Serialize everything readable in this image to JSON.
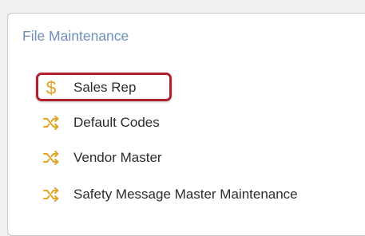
{
  "section": {
    "title": "File Maintenance"
  },
  "menu": {
    "items": [
      {
        "label": "Sales Rep",
        "icon": "dollar-icon",
        "highlighted": true
      },
      {
        "label": "Default Codes",
        "icon": "shuffle-icon",
        "highlighted": false
      },
      {
        "label": "Vendor Master",
        "icon": "shuffle-icon",
        "highlighted": false
      },
      {
        "label": "Safety Message Master Maintenance",
        "icon": "shuffle-icon",
        "highlighted": false
      }
    ]
  },
  "colors": {
    "title": "#6d8fb9",
    "icon": "#e0a526",
    "highlight": "#b3202d",
    "text": "#2c2c2c"
  }
}
